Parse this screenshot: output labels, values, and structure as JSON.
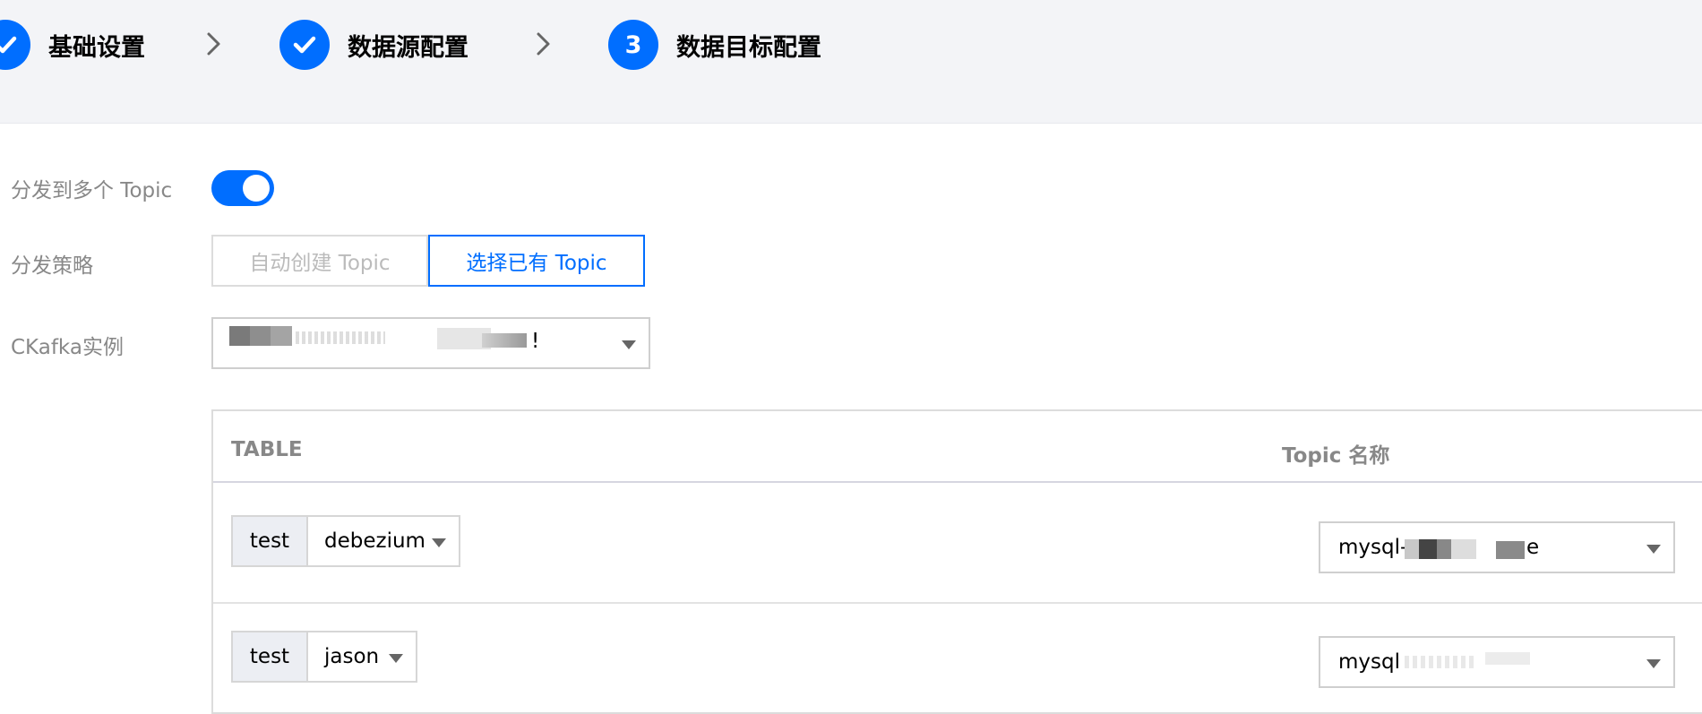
{
  "steps": [
    {
      "status": "done",
      "title": "基础设置"
    },
    {
      "status": "done",
      "title": "数据源配置"
    },
    {
      "status": "active",
      "number": "3",
      "title": "数据目标配置"
    }
  ],
  "form": {
    "multi_topic_label": "分发到多个 Topic",
    "multi_topic_enabled": true,
    "strategy_label": "分发策略",
    "strategy_options": [
      "自动创建 Topic",
      "选择已有 Topic"
    ],
    "strategy_selected": "选择已有 Topic",
    "instance_label": "CKafka实例",
    "instance_value": "!"
  },
  "table": {
    "headers": [
      "TABLE",
      "Topic 名称"
    ],
    "rows": [
      {
        "database": "test",
        "table": "debezium",
        "topic": "mysql-",
        "topic_tail": "e"
      },
      {
        "database": "test",
        "table": "jason",
        "topic": "mysql",
        "topic_tail": ""
      }
    ]
  },
  "colors": {
    "primary": "#006eff",
    "steps_background": "#f3f4f7",
    "label_gray": "#888888"
  }
}
